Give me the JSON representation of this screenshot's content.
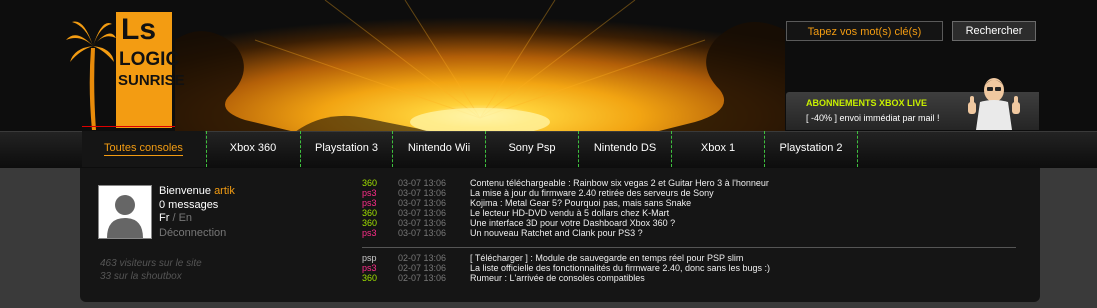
{
  "logo": {
    "line1": "Ls",
    "line2": "LOGIC",
    "line3": "SUNRISE"
  },
  "search": {
    "placeholder": "Tapez vos mot(s) clé(s)",
    "button_label": "Rechercher"
  },
  "promo": {
    "title": "ABONNEMENTS XBOX LIVE",
    "subtitle": "[ -40% ] envoi immédiat par mail !"
  },
  "nav": {
    "items": [
      {
        "label": "Toutes consoles",
        "active": true
      },
      {
        "label": "Xbox 360"
      },
      {
        "label": "Playstation 3"
      },
      {
        "label": "Nintendo Wii"
      },
      {
        "label": "Sony Psp"
      },
      {
        "label": "Nintendo DS"
      },
      {
        "label": "Xbox 1"
      },
      {
        "label": "Playstation 2"
      }
    ]
  },
  "user": {
    "welcome": "Bienvenue",
    "username": "artik",
    "messages": "0 messages",
    "lang_fr": "Fr",
    "lang_sep": " / ",
    "lang_en": "En",
    "logout": "Déconnection"
  },
  "stats": {
    "visitors": "463 visiteurs sur le site",
    "shoutbox": "33 sur la shoutbox"
  },
  "news_top": [
    {
      "platform": "360",
      "date": "03-07 13:06",
      "title": "Contenu téléchargeable : Rainbow six vegas 2 et Guitar Hero 3 à l'honneur"
    },
    {
      "platform": "ps3",
      "date": "03-07 13:06",
      "title": "La mise à jour du firmware 2.40 retirée des serveurs de Sony"
    },
    {
      "platform": "ps3",
      "date": "03-07 13:06",
      "title": "Kojima : Metal Gear 5? Pourquoi pas, mais sans Snake"
    },
    {
      "platform": "360",
      "date": "03-07 13:06",
      "title": "Le lecteur HD-DVD vendu à 5 dollars chez K-Mart"
    },
    {
      "platform": "360",
      "date": "03-07 13:06",
      "title": "Une interface 3D pour votre Dashboard Xbox 360 ?"
    },
    {
      "platform": "ps3",
      "date": "03-07 13:06",
      "title": "Un nouveau Ratchet and Clank pour PS3 ?"
    }
  ],
  "news_bottom": [
    {
      "platform": "psp",
      "date": "02-07 13:06",
      "title": "[ Télécharger ] : Module de sauvegarde en temps réel pour PSP slim"
    },
    {
      "platform": "ps3",
      "date": "02-07 13:06",
      "title": "La liste officielle des fonctionnalités du firmware 2.40, donc sans les bugs :)"
    },
    {
      "platform": "360",
      "date": "02-07 13:06",
      "title": "Rumeur : L'arrivée de consoles compatibles"
    }
  ],
  "colors": {
    "accent": "#f39c12",
    "x360": "#9ee000",
    "ps3": "#ff2d8a",
    "promo_title": "#c8f000"
  }
}
